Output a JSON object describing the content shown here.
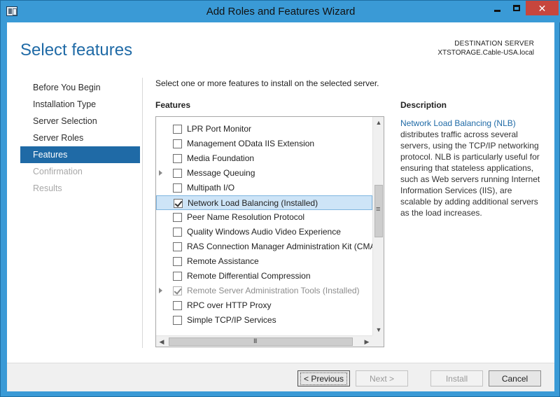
{
  "window": {
    "title": "Add Roles and Features Wizard",
    "close_glyph": "✕"
  },
  "header": {
    "page_title": "Select features",
    "destination_label": "DESTINATION SERVER",
    "destination_server": "XTSTORAGE.Cable-USA.local"
  },
  "nav": {
    "items": [
      {
        "label": "Before You Begin",
        "state": "normal"
      },
      {
        "label": "Installation Type",
        "state": "normal"
      },
      {
        "label": "Server Selection",
        "state": "normal"
      },
      {
        "label": "Server Roles",
        "state": "normal"
      },
      {
        "label": "Features",
        "state": "active"
      },
      {
        "label": "Confirmation",
        "state": "disabled"
      },
      {
        "label": "Results",
        "state": "disabled"
      }
    ]
  },
  "main": {
    "instruction": "Select one or more features to install on the selected server.",
    "features_heading": "Features",
    "features": [
      {
        "label": "LPR Port Monitor",
        "checked": false,
        "expandable": false,
        "disabled": false,
        "selected": false
      },
      {
        "label": "Management OData IIS Extension",
        "checked": false,
        "expandable": false,
        "disabled": false,
        "selected": false
      },
      {
        "label": "Media Foundation",
        "checked": false,
        "expandable": false,
        "disabled": false,
        "selected": false
      },
      {
        "label": "Message Queuing",
        "checked": false,
        "expandable": true,
        "disabled": false,
        "selected": false
      },
      {
        "label": "Multipath I/O",
        "checked": false,
        "expandable": false,
        "disabled": false,
        "selected": false
      },
      {
        "label": "Network Load Balancing (Installed)",
        "checked": true,
        "expandable": false,
        "disabled": false,
        "selected": true
      },
      {
        "label": "Peer Name Resolution Protocol",
        "checked": false,
        "expandable": false,
        "disabled": false,
        "selected": false
      },
      {
        "label": "Quality Windows Audio Video Experience",
        "checked": false,
        "expandable": false,
        "disabled": false,
        "selected": false
      },
      {
        "label": "RAS Connection Manager Administration Kit (CMA",
        "checked": false,
        "expandable": false,
        "disabled": false,
        "selected": false
      },
      {
        "label": "Remote Assistance",
        "checked": false,
        "expandable": false,
        "disabled": false,
        "selected": false
      },
      {
        "label": "Remote Differential Compression",
        "checked": false,
        "expandable": false,
        "disabled": false,
        "selected": false
      },
      {
        "label": "Remote Server Administration Tools (Installed)",
        "checked": true,
        "expandable": true,
        "disabled": true,
        "selected": false
      },
      {
        "label": "RPC over HTTP Proxy",
        "checked": false,
        "expandable": false,
        "disabled": false,
        "selected": false
      },
      {
        "label": "Simple TCP/IP Services",
        "checked": false,
        "expandable": false,
        "disabled": false,
        "selected": false
      }
    ],
    "scroll_up_glyph": "▲",
    "scroll_down_glyph": "▼",
    "scroll_left_glyph": "◀",
    "scroll_right_glyph": "▶"
  },
  "description": {
    "heading": "Description",
    "link_text": "Network Load Balancing (NLB)",
    "body": " distributes traffic across several servers, using the TCP/IP networking protocol. NLB is particularly useful for ensuring that stateless applications, such as Web servers running Internet Information Services (IIS), are scalable by adding additional servers as the load increases."
  },
  "footer": {
    "previous_label": "< Previous",
    "next_label": "Next >",
    "install_label": "Install",
    "cancel_label": "Cancel"
  }
}
